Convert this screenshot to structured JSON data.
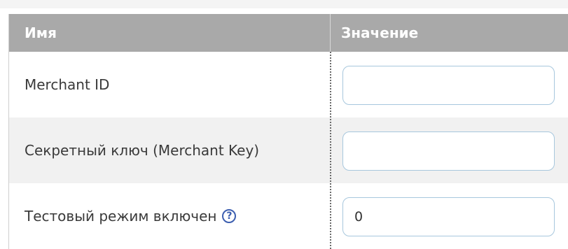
{
  "table": {
    "headers": {
      "name": "Имя",
      "value": "Значение"
    },
    "rows": [
      {
        "label": "Merchant ID",
        "value": ""
      },
      {
        "label": "Секретный ключ (Merchant Key)",
        "value": ""
      },
      {
        "label": "Тестовый режим включен",
        "value": "0",
        "help_icon": "help-icon",
        "help_glyph": "?"
      }
    ]
  },
  "colors": {
    "header_bg": "#a9a9a9",
    "alt_row_bg": "#f1f1f1",
    "input_border": "#a7c7dd",
    "help_icon": "#3d5fb0"
  }
}
